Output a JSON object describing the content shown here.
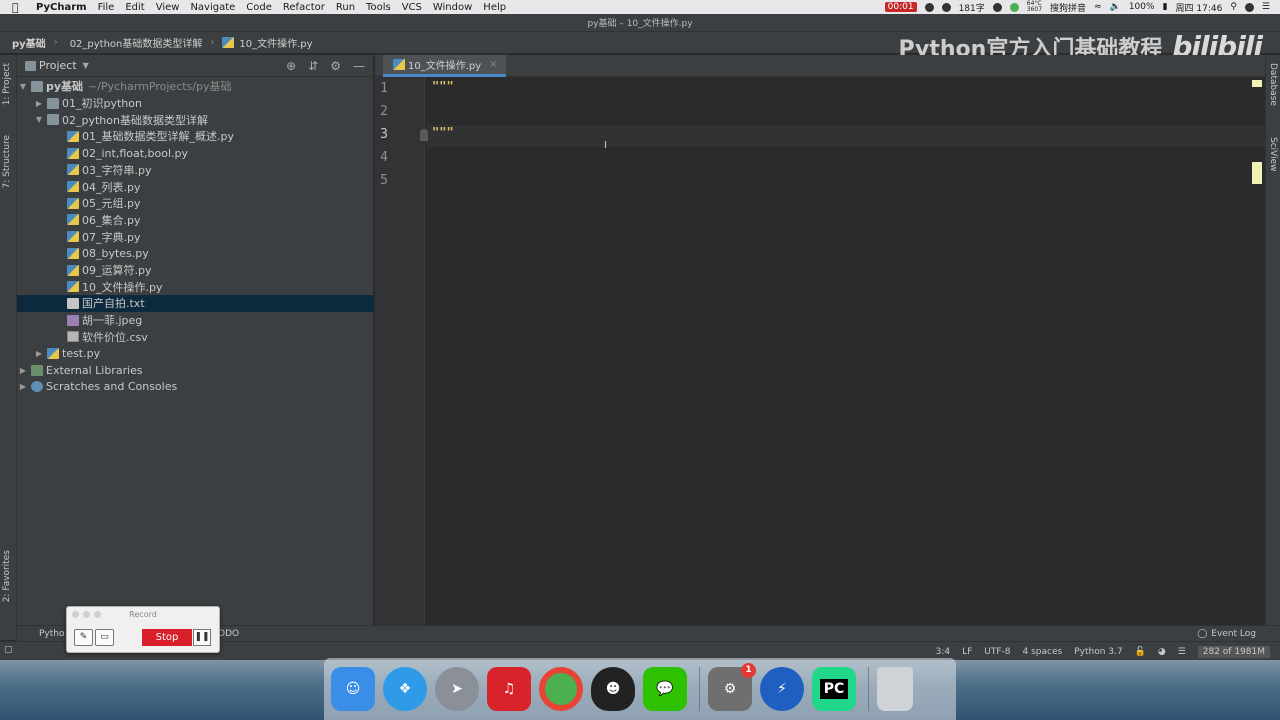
{
  "menubar": {
    "app": "PyCharm",
    "items": [
      "File",
      "Edit",
      "View",
      "Navigate",
      "Code",
      "Refactor",
      "Run",
      "Tools",
      "VCS",
      "Window",
      "Help"
    ],
    "window_title": "py基础 – 10_文件操作.py",
    "rec_time": "00:01",
    "char_count": "181字",
    "temp": "64°C",
    "fan": "3607",
    "ime": "搜狗拼音",
    "battery": "100%",
    "clock": "周四 17:46"
  },
  "navbar": {
    "crumbs": [
      "py基础",
      "02_python基础数据类型详解",
      "10_文件操作.py"
    ]
  },
  "watermark": {
    "text": "Python官方入门基础教程",
    "logo": "bilibili"
  },
  "leftstrip": {
    "project_tab": "1: Project",
    "structure_tab": "7: Structure",
    "favorites_tab": "2: Favorites"
  },
  "project": {
    "header": "Project",
    "root": {
      "name": "py基础",
      "path": "~/PycharmProjects/py基础"
    },
    "items": [
      {
        "label": "01_初识python",
        "icon": "folder-icon"
      },
      {
        "label": "02_python基础数据类型详解",
        "icon": "folder-icon"
      },
      {
        "label": "01_基础数据类型详解_概述.py",
        "icon": "python-file-icon"
      },
      {
        "label": "02_int,float,bool.py",
        "icon": "python-file-icon"
      },
      {
        "label": "03_字符串.py",
        "icon": "python-file-icon"
      },
      {
        "label": "04_列表.py",
        "icon": "python-file-icon"
      },
      {
        "label": "05_元组.py",
        "icon": "python-file-icon"
      },
      {
        "label": "06_集合.py",
        "icon": "python-file-icon"
      },
      {
        "label": "07_字典.py",
        "icon": "python-file-icon"
      },
      {
        "label": "08_bytes.py",
        "icon": "python-file-icon"
      },
      {
        "label": "09_运算符.py",
        "icon": "python-file-icon"
      },
      {
        "label": "10_文件操作.py",
        "icon": "python-file-icon"
      },
      {
        "label": "国产自拍.txt",
        "icon": "text-file-icon"
      },
      {
        "label": "胡一菲.jpeg",
        "icon": "image-file-icon"
      },
      {
        "label": "软件价位.csv",
        "icon": "csv-file-icon"
      },
      {
        "label": "test.py",
        "icon": "python-file-icon"
      },
      {
        "label": "External Libraries",
        "icon": "library-icon"
      },
      {
        "label": "Scratches and Consoles",
        "icon": "scratches-icon"
      }
    ]
  },
  "editor": {
    "tab": "10_文件操作.py",
    "line_numbers": [
      "1",
      "2",
      "3",
      "4",
      "5"
    ],
    "lines": [
      "\"\"\"",
      "",
      "\"\"\"",
      "",
      ""
    ]
  },
  "rightstrip": {
    "database_tab": "Database",
    "sciview_tab": "SciView"
  },
  "toolstrip": {
    "python_tab": "Pytho",
    "todo_tab": "TODO",
    "event_log": "Event Log"
  },
  "statusbar": {
    "position": "3:4",
    "line_sep": "LF",
    "encoding": "UTF-8",
    "indent": "4 spaces",
    "interpreter": "Python 3.7",
    "memory": "282 of 1981M"
  },
  "recorder": {
    "title": "Record",
    "stop_label": "Stop"
  },
  "dock": {
    "apps": [
      {
        "name": "finder-icon",
        "color": "#3b8ee8"
      },
      {
        "name": "safari-icon",
        "color": "#2f9be8"
      },
      {
        "name": "launchpad-icon",
        "color": "#8a8f98"
      },
      {
        "name": "netease-music-icon",
        "color": "#d8232a"
      },
      {
        "name": "chrome-icon",
        "color": "#4caf50"
      },
      {
        "name": "qq-icon",
        "color": "#222222"
      },
      {
        "name": "wechat-icon",
        "color": "#2dc100"
      },
      {
        "name": "system-preferences-icon",
        "color": "#6f6f6f"
      },
      {
        "name": "thunder-icon",
        "color": "#1f5fbf"
      },
      {
        "name": "pycharm-icon",
        "color": "#21d789"
      },
      {
        "name": "trash-icon",
        "color": "#cfd3d8"
      }
    ],
    "badge": "1",
    "pycharm_text": "PC"
  }
}
